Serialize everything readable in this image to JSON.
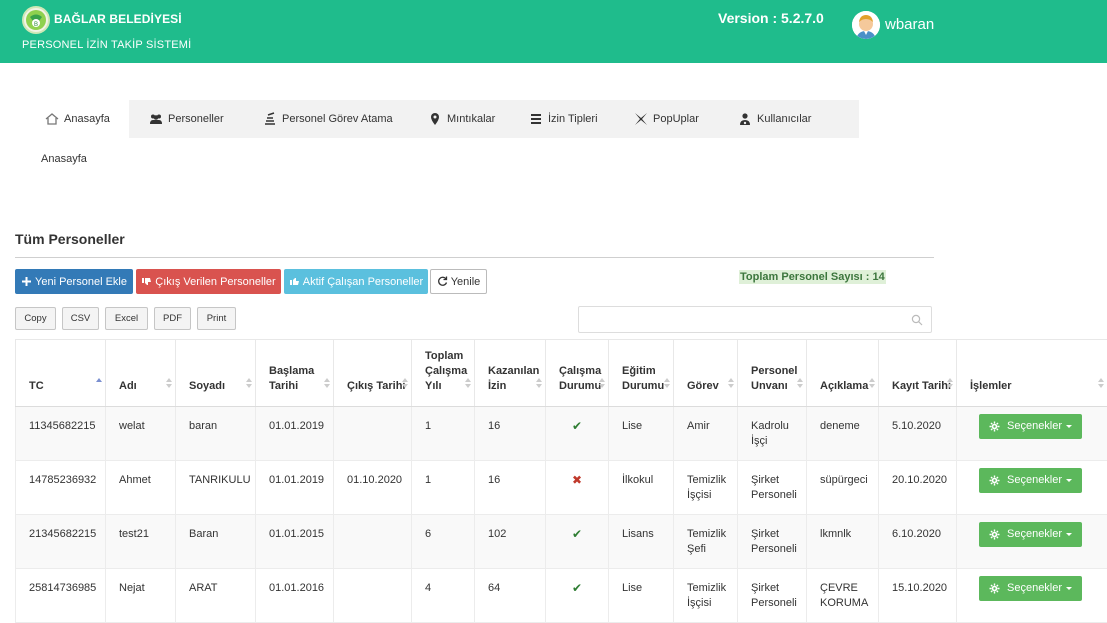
{
  "header": {
    "org_name": "BAĞLAR BELEDİYESİ",
    "system_name": "PERSONEL İZİN TAKİP SİSTEMİ",
    "version": "Version : 5.2.7.0",
    "username": "wbaran",
    "color": "#1fbc8c"
  },
  "tabs": [
    {
      "label": "Anasayfa",
      "icon": "home-icon",
      "active": true
    },
    {
      "label": "Personeller",
      "icon": "users-icon"
    },
    {
      "label": "Personel Görev Atama",
      "icon": "assign-icon"
    },
    {
      "label": "Mıntıkalar",
      "icon": "map-marker-icon"
    },
    {
      "label": "İzin Tipleri",
      "icon": "list-icon"
    },
    {
      "label": "PopUplar",
      "icon": "popup-icon"
    },
    {
      "label": "Kullanıcılar",
      "icon": "user-gear-icon"
    }
  ],
  "breadcrumb": "Anasayfa",
  "section_title": "Tüm Personeller",
  "actions": {
    "new_personnel": "Yeni Personel Ekle",
    "exited_personnel": "Çıkış Verilen Personeller",
    "active_personnel": "Aktif Çalışan Personeller",
    "refresh": "Yenile"
  },
  "total_label": "Toplam Personel Sayısı : 14",
  "export_buttons": [
    "Copy",
    "CSV",
    "Excel",
    "PDF",
    "Print"
  ],
  "search": {
    "placeholder": ""
  },
  "table": {
    "headers": [
      "TC",
      "Adı",
      "Soyadı",
      "Başlama Tarihi",
      "Çıkış Tarihi",
      "Toplam Çalışma Yılı",
      "Kazanılan İzin",
      "Çalışma Durumu",
      "Eğitim Durumu",
      "Görev",
      "Personel Unvanı",
      "Açıklama",
      "Kayıt Tarihi",
      "İşlemler"
    ],
    "options_label": "Seçenekler",
    "rows": [
      {
        "tc": "11345682215",
        "adi": "welat",
        "soyadi": "baran",
        "baslama": "01.01.2019",
        "cikis": "",
        "yil": "1",
        "izin": "16",
        "durum": "active",
        "egitim": "Lise",
        "gorev": "Amir",
        "unvan": "Kadrolu İşçi",
        "aciklama": "deneme",
        "kayit": "5.10.2020"
      },
      {
        "tc": "14785236932",
        "adi": "Ahmet",
        "soyadi": "TANRIKULU",
        "baslama": "01.01.2019",
        "cikis": "01.10.2020",
        "yil": "1",
        "izin": "16",
        "durum": "inactive",
        "egitim": "İlkokul",
        "gorev": "Temizlik İşçisi",
        "unvan": "Şirket Personeli",
        "aciklama": "süpürgeci",
        "kayit": "20.10.2020"
      },
      {
        "tc": "21345682215",
        "adi": "test21",
        "soyadi": "Baran",
        "baslama": "01.01.2015",
        "cikis": "",
        "yil": "6",
        "izin": "102",
        "durum": "active",
        "egitim": "Lisans",
        "gorev": "Temizlik Şefi",
        "unvan": "Şirket Personeli",
        "aciklama": "lkmnlk",
        "kayit": "6.10.2020"
      },
      {
        "tc": "25814736985",
        "adi": "Nejat",
        "soyadi": "ARAT",
        "baslama": "01.01.2016",
        "cikis": "",
        "yil": "4",
        "izin": "64",
        "durum": "active",
        "egitim": "Lise",
        "gorev": "Temizlik İşçisi",
        "unvan": "Şirket Personeli",
        "aciklama": "ÇEVRE KORUMA",
        "kayit": "15.10.2020"
      }
    ]
  }
}
